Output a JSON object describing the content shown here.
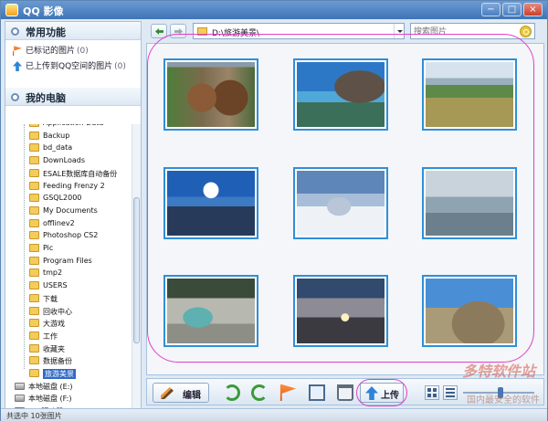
{
  "window": {
    "title": "QQ 影像"
  },
  "sidebar": {
    "favorites_title": "常用功能",
    "favorites": [
      {
        "label": "已标记的图片",
        "count": "(0)",
        "icon": "flag-icon"
      },
      {
        "label": "已上传到QQ空间的图片",
        "count": "(0)",
        "icon": "upload-icon"
      }
    ],
    "computer_title": "我的电脑",
    "folders": [
      "Application Data",
      "Backup",
      "bd_data",
      "DownLoads",
      "ESALE数据库自动备份",
      "Feeding Frenzy 2",
      "GSQL2000",
      "My Documents",
      "offlinev2",
      "Photoshop CS2",
      "Pic",
      "Program Files",
      "tmp2",
      "USERS",
      "下载",
      "回收中心",
      "大游戏",
      "工作",
      "收藏夹",
      "数据备份",
      "旅游美景"
    ],
    "selected_folder": "旅游美景",
    "drives": [
      "本地磁盘 (E:)",
      "本地磁盘 (F:)",
      "CD 驱动器 (G:)"
    ]
  },
  "address": {
    "path": "D:\\旅游美景\\",
    "search_placeholder": "搜索图片"
  },
  "thumbnails": [
    {
      "name": "waterwheel"
    },
    {
      "name": "sea-rock"
    },
    {
      "name": "grassland"
    },
    {
      "name": "tower-sky"
    },
    {
      "name": "snow-village"
    },
    {
      "name": "lake"
    },
    {
      "name": "stream"
    },
    {
      "name": "sunset"
    },
    {
      "name": "mountain"
    }
  ],
  "toolbar": {
    "edit_label": "编辑",
    "upload_label": "上传"
  },
  "watermark": {
    "brand": "多特软件站",
    "slogan": "国内最安全的软件站"
  },
  "status": {
    "text": "共选中 10张图片"
  },
  "colors": {
    "accent": "#2f8fd8",
    "highlight": "#e040c8",
    "title_bar": "#3f74b6"
  }
}
